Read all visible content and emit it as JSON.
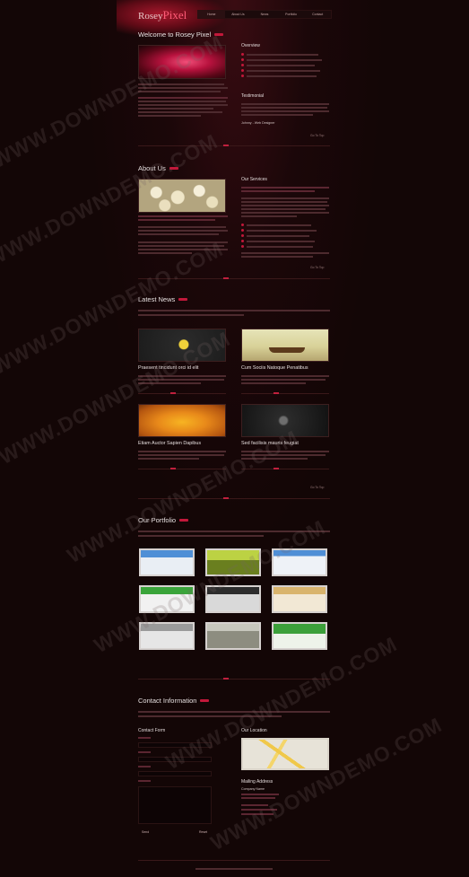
{
  "header": {
    "logo_main": "Rosey",
    "logo_accent": "Pixel",
    "nav": [
      "Home",
      "About Us",
      "News",
      "Portfolio",
      "Contact"
    ]
  },
  "welcome": {
    "title": "Welcome to Rosey Pixel",
    "overview_title": "Overview",
    "testimonial_title": "Testimonial",
    "testimonial_author": "Johnny - Web Designer",
    "to_top": "Go To Top"
  },
  "about": {
    "title": "About Us",
    "services_title": "Our Services",
    "to_top": "Go To Top"
  },
  "news": {
    "title": "Latest News",
    "items": [
      "Praesent tincidunt orci id elit",
      "Cum Sociis Natoque Penatibus",
      "Etiam Auctor Sapien Dapibus",
      "Sed facilisis mauris feugiat"
    ],
    "to_top": "Go To Top"
  },
  "portfolio": {
    "title": "Our Portfolio"
  },
  "contact": {
    "title": "Contact Information",
    "form_title": "Contact Form",
    "location_title": "Our Location",
    "mailing_title": "Mailing Address",
    "company_name": "Company Name",
    "send": "Send",
    "reset": "Reset"
  },
  "watermark": "WWW.DOWNDEMO.COM",
  "colors": {
    "accent": "#c2183a",
    "background": "#130606"
  }
}
